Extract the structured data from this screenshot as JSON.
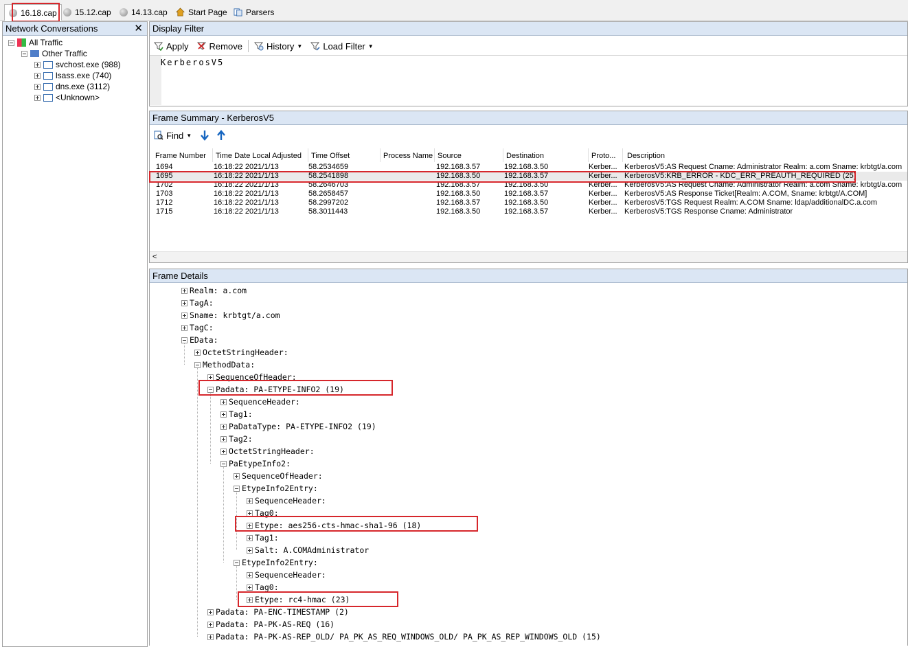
{
  "tabs": [
    {
      "label": "16.18.cap",
      "active": true
    },
    {
      "label": "15.12.cap",
      "active": false
    },
    {
      "label": "14.13.cap",
      "active": false
    },
    {
      "label": "Start Page",
      "active": false
    },
    {
      "label": "Parsers",
      "active": false
    }
  ],
  "network_conversations": {
    "title": "Network Conversations",
    "close_glyph": "✕",
    "items": [
      {
        "label": "All Traffic"
      },
      {
        "label": "Other Traffic"
      },
      {
        "label": "svchost.exe (988)"
      },
      {
        "label": "lsass.exe (740)"
      },
      {
        "label": "dns.exe (3112)"
      },
      {
        "label": "<Unknown>"
      }
    ]
  },
  "display_filter": {
    "title": "Display Filter",
    "apply_label": "Apply",
    "remove_label": "Remove",
    "history_label": "History",
    "load_filter_label": "Load Filter",
    "filter_text": "KerberosV5"
  },
  "frame_summary": {
    "title": "Frame Summary - KerberosV5",
    "find_label": "Find",
    "columns": [
      "Frame Number",
      "Time Date Local Adjusted",
      "Time Offset",
      "Process Name",
      "Source",
      "Destination",
      "Proto...",
      "Description"
    ],
    "rows": [
      [
        "1694",
        "16:18:22 2021/1/13",
        "58.2534659",
        "",
        "192.168.3.57",
        "192.168.3.50",
        "Kerber...",
        "KerberosV5:AS Request Cname: Administrator Realm: a.com Sname: krbtgt/a.com"
      ],
      [
        "1695",
        "16:18:22 2021/1/13",
        "58.2541898",
        "",
        "192.168.3.50",
        "192.168.3.57",
        "Kerber...",
        "KerberosV5:KRB_ERROR  - KDC_ERR_PREAUTH_REQUIRED (25)"
      ],
      [
        "1702",
        "16:18:22 2021/1/13",
        "58.2646703",
        "",
        "192.168.3.57",
        "192.168.3.50",
        "Kerber...",
        "KerberosV5:AS Request Cname: Administrator Realm: a.com Sname: krbtgt/a.com"
      ],
      [
        "1703",
        "16:18:22 2021/1/13",
        "58.2658457",
        "",
        "192.168.3.50",
        "192.168.3.57",
        "Kerber...",
        "KerberosV5:AS Response Ticket[Realm: A.COM, Sname: krbtgt/A.COM]"
      ],
      [
        "1712",
        "16:18:22 2021/1/13",
        "58.2997202",
        "",
        "192.168.3.57",
        "192.168.3.50",
        "Kerber...",
        "KerberosV5:TGS Request Realm: A.COM Sname: ldap/additionalDC.a.com"
      ],
      [
        "1715",
        "16:18:22 2021/1/13",
        "58.3011443",
        "",
        "192.168.3.50",
        "192.168.3.57",
        "Kerber...",
        "KerberosV5:TGS Response Cname: Administrator"
      ]
    ],
    "scroll_left_glyph": "<"
  },
  "frame_details": {
    "title": "Frame Details",
    "rows": [
      {
        "text": "Realm: a.com",
        "expanded": false
      },
      {
        "text": "TagA:",
        "expanded": false
      },
      {
        "text": "Sname: krbtgt/a.com",
        "expanded": false
      },
      {
        "text": "TagC:",
        "expanded": false
      },
      {
        "text": "EData:",
        "expanded": true
      },
      {
        "text": "OctetStringHeader:",
        "expanded": false
      },
      {
        "text": "MethodData:",
        "expanded": true
      },
      {
        "text": "SequenceOfHeader:",
        "expanded": false
      },
      {
        "text": "Padata: PA-ETYPE-INFO2 (19)",
        "expanded": true
      },
      {
        "text": "SequenceHeader:",
        "expanded": false
      },
      {
        "text": "Tag1:",
        "expanded": false
      },
      {
        "text": "PaDataType: PA-ETYPE-INFO2 (19)",
        "expanded": false
      },
      {
        "text": "Tag2:",
        "expanded": false
      },
      {
        "text": "OctetStringHeader:",
        "expanded": false
      },
      {
        "text": "PaEtypeInfo2:",
        "expanded": true
      },
      {
        "text": "SequenceOfHeader:",
        "expanded": false
      },
      {
        "text": "EtypeInfo2Entry:",
        "expanded": true
      },
      {
        "text": "SequenceHeader:",
        "expanded": false
      },
      {
        "text": "Tag0:",
        "expanded": false
      },
      {
        "text": "Etype: aes256-cts-hmac-sha1-96 (18)",
        "expanded": false
      },
      {
        "text": "Tag1:",
        "expanded": false
      },
      {
        "text": "Salt: A.COMAdministrator",
        "expanded": false
      },
      {
        "text": "EtypeInfo2Entry:",
        "expanded": true
      },
      {
        "text": "SequenceHeader:",
        "expanded": false
      },
      {
        "text": "Tag0:",
        "expanded": false
      },
      {
        "text": "Etype: rc4-hmac (23)",
        "expanded": false
      },
      {
        "text": "Padata: PA-ENC-TIMESTAMP (2)",
        "expanded": false
      },
      {
        "text": "Padata: PA-PK-AS-REQ (16)",
        "expanded": false
      },
      {
        "text": "Padata: PA-PK-AS-REP_OLD/ PA_PK_AS_REQ_WINDOWS_OLD/ PA_PK_AS_REP_WINDOWS_OLD (15)",
        "expanded": false
      }
    ]
  },
  "colors": {
    "highlight": "#d6262b",
    "header_bg": "#dbe6f4",
    "accent_blue": "#1565c0"
  }
}
